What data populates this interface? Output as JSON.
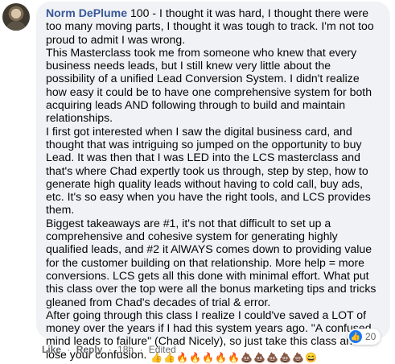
{
  "comment": {
    "author": "Norm DePlume",
    "paragraphs": [
      " 100 - I thought it was hard, I thought there were too many moving parts, I thought it was tough to track. I'm not too proud to admit I was wrong.",
      "This Masterclass took me from someone who knew that every business needs leads, but I still knew very little about the possibility of a unified Lead Conversion System. I didn't realize how easy it could be to have one comprehensive system for both acquiring leads AND following through to build and maintain relationships.",
      "I first got interested when I saw the digital business card, and thought that was intriguing so jumped on the opportunity to buy Lead. It was then that I was LED into the LCS masterclass and that's where Chad expertly took us through, step by step, how to generate high quality leads without having to cold call, buy ads, etc. It's so easy when you have the right tools, and LCS provides them.",
      "Biggest takeaways are #1, it's not that difficult to set up a comprehensive and cohesive system for generating highly qualified leads, and #2 it AlWAYS comes down to providing value for the customer building on that relationship. More help = more conversions. LCS gets all this done with minimal effort. What put this class over the top were all the bonus marketing tips and tricks gleaned from Chad's decades of trial & error.",
      "After going through this class I realize I could've saved a LOT of money over the years if I had this system years ago. \"A confused mind leads to failure\" (Chad Nicely), so just take this class and lose your confusion."
    ],
    "emojis": [
      {
        "icon": "thumbs-up-icon",
        "glyph": "👍"
      },
      {
        "icon": "thumbs-up-icon",
        "glyph": "👍"
      },
      {
        "icon": "fire-icon",
        "glyph": "🔥"
      },
      {
        "icon": "fire-icon",
        "glyph": "🔥"
      },
      {
        "icon": "fire-icon",
        "glyph": "🔥"
      },
      {
        "icon": "fire-icon",
        "glyph": "🔥"
      },
      {
        "icon": "fire-icon",
        "glyph": "🔥"
      },
      {
        "icon": "poop-icon",
        "glyph": "💩"
      },
      {
        "icon": "poop-icon",
        "glyph": "💩"
      },
      {
        "icon": "poop-icon",
        "glyph": "💩"
      },
      {
        "icon": "poop-icon",
        "glyph": "💩"
      },
      {
        "icon": "poop-icon",
        "glyph": "💩"
      },
      {
        "icon": "grinning-face-icon",
        "glyph": "😄"
      }
    ]
  },
  "reactions": {
    "icon": "like-icon",
    "count": "20"
  },
  "actions": {
    "like": "Like",
    "reply": "Reply",
    "time": "18h",
    "edited": "Edited",
    "separator": "·"
  },
  "colors": {
    "bubble": "#f0f2f5",
    "author": "#385898",
    "meta": "#65676b",
    "like_blue": "#1877f2"
  }
}
